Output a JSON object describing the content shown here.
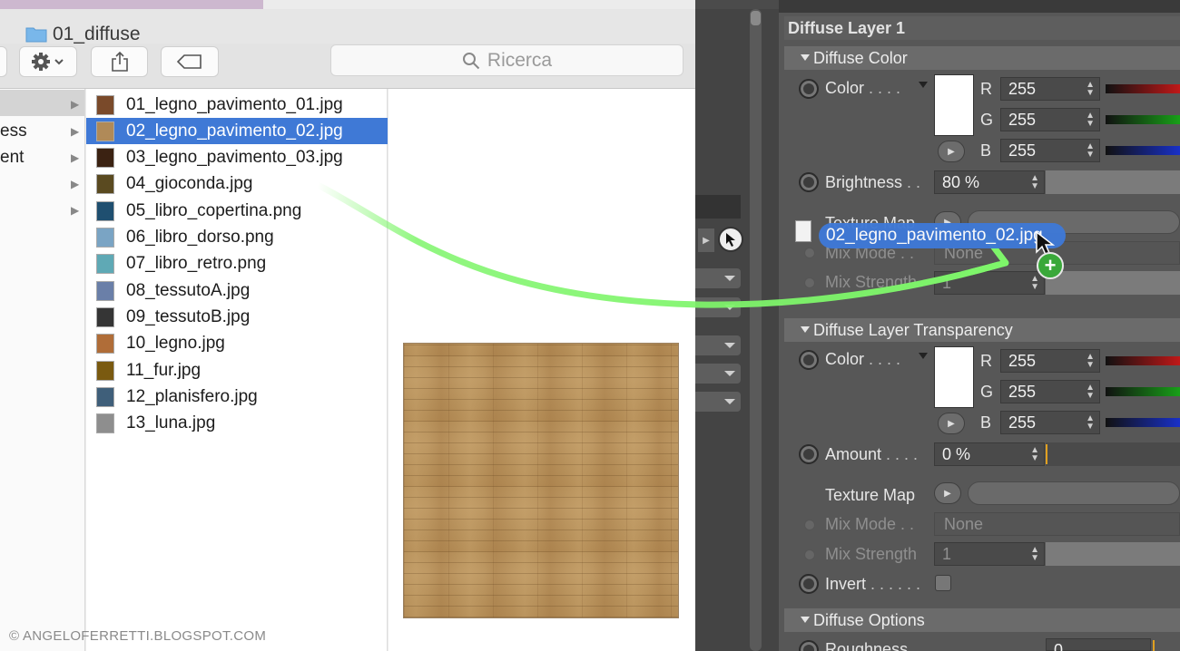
{
  "finder": {
    "title": "01_diffuse",
    "search_placeholder": "Ricerca",
    "sidebar": [
      {
        "label": ""
      },
      {
        "label": "ess"
      },
      {
        "label": "ent"
      },
      {
        "label": ""
      },
      {
        "label": ""
      }
    ],
    "files": [
      {
        "name": "01_legno_pavimento_01.jpg",
        "thumb": "#7a4a2a"
      },
      {
        "name": "02_legno_pavimento_02.jpg",
        "thumb": "#b08a58"
      },
      {
        "name": "03_legno_pavimento_03.jpg",
        "thumb": "#3b2212"
      },
      {
        "name": "04_gioconda.jpg",
        "thumb": "#5a4a20"
      },
      {
        "name": "05_libro_copertina.png",
        "thumb": "#1f4f70"
      },
      {
        "name": "06_libro_dorso.png",
        "thumb": "#7aa4c4"
      },
      {
        "name": "07_libro_retro.png",
        "thumb": "#5fa9b5"
      },
      {
        "name": "08_tessutoA.jpg",
        "thumb": "#6a7fa8"
      },
      {
        "name": "09_tessutoB.jpg",
        "thumb": "#353535"
      },
      {
        "name": "10_legno.jpg",
        "thumb": "#b06d38"
      },
      {
        "name": "11_fur.jpg",
        "thumb": "#7a5a10"
      },
      {
        "name": "12_planisfero.jpg",
        "thumb": "#3f5f7a"
      },
      {
        "name": "13_luna.jpg",
        "thumb": "#8e8e8e"
      }
    ],
    "selected_index": 1,
    "selection_color": "#3f79d6"
  },
  "attributes": {
    "panel_title": "Diffuse Layer 1",
    "section_diffuse_color": "Diffuse Color",
    "color_label": "Color",
    "color_dots": " . . . .",
    "r_label": "R",
    "g_label": "G",
    "b_label": "B",
    "r_value": "255",
    "g_value": "255",
    "b_value": "255",
    "brightness_label": "Brightness",
    "brightness_dots": " . .",
    "brightness_value": "80 %",
    "texture_map_label": "Texture Map",
    "mix_mode_label": "Mix Mode",
    "mix_mode_dots": " . .",
    "mix_mode_value": "None",
    "mix_strength_label": "Mix Strength",
    "mix_strength_value": "1",
    "section_transparency": "Diffuse Layer Transparency",
    "t_color_label": "Color",
    "t_r_value": "255",
    "t_g_value": "255",
    "t_b_value": "255",
    "amount_label": "Amount",
    "amount_dots": " . . . .",
    "amount_value": "0 %",
    "t_texture_map_label": "Texture Map",
    "t_mix_mode_label": "Mix Mode",
    "t_mix_mode_value": "None",
    "t_mix_strength_label": "Mix Strength",
    "t_mix_strength_value": "1",
    "invert_label": "Invert",
    "invert_dots": " . . . . . .",
    "section_options": "Diffuse Options",
    "roughness_label": "Roughness",
    "roughness_value": "0"
  },
  "drag": {
    "filename": "02_legno_pavimento_02.jpg",
    "arrow_color": "#7ef56a"
  },
  "watermark": "© ANGELOFERRETTI.BLOGSPOT.COM"
}
